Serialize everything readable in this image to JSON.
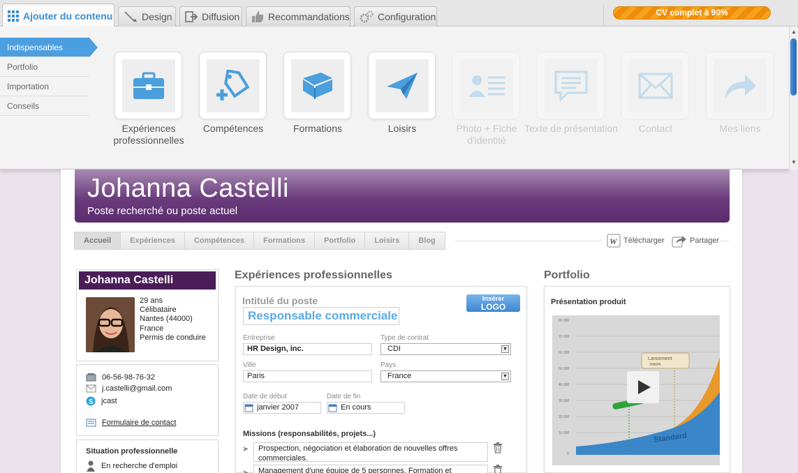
{
  "topbar": {
    "tabs": [
      {
        "label": "Ajouter du contenu",
        "icon": "grid-icon"
      },
      {
        "label": "Design",
        "icon": "brush-icon"
      },
      {
        "label": "Diffusion",
        "icon": "export-icon"
      },
      {
        "label": "Recommandations",
        "icon": "thumbs-up-icon"
      },
      {
        "label": "Configuration",
        "icon": "gears-icon"
      }
    ],
    "progress_label": "CV complet à 90%",
    "progress": 0.9
  },
  "panel": {
    "sidebar": [
      "Indispensables",
      "Portfolio",
      "Importation",
      "Conseils"
    ],
    "tiles": [
      {
        "label": "Expériences professionnelles",
        "icon": "briefcase-icon",
        "enabled": true
      },
      {
        "label": "Compétences",
        "icon": "tag-plus-icon",
        "enabled": true
      },
      {
        "label": "Formations",
        "icon": "book-icon",
        "enabled": true
      },
      {
        "label": "Loisirs",
        "icon": "paper-plane-icon",
        "enabled": true
      },
      {
        "label": "Photo + Fiche d'identité",
        "icon": "id-card-icon",
        "enabled": false
      },
      {
        "label": "Texte de présentation",
        "icon": "speech-bubble-icon",
        "enabled": false
      },
      {
        "label": "Contact",
        "icon": "envelope-icon",
        "enabled": false
      },
      {
        "label": "Mes liens",
        "icon": "link-arrow-icon",
        "enabled": false
      }
    ]
  },
  "header": {
    "name": "Johanna Castelli",
    "subtitle": "Poste recherché ou poste actuel"
  },
  "nav": {
    "tabs": [
      "Accueil",
      "Expériences",
      "Compétences",
      "Formations",
      "Portfolio",
      "Loisirs",
      "Blog"
    ],
    "download_label": "Télécharger",
    "share_label": "Partager"
  },
  "profile": {
    "name": "Johanna Castelli",
    "age": "29 ans",
    "status": "Célibataire",
    "city": "Nantes (44000)",
    "country": "France",
    "license": "Permis de conduire",
    "phone": "06-56-98-76-32",
    "email": "j.castelli@gmail.com",
    "skype": "jcast",
    "contact_form": "Formulaire de contact",
    "situation_title": "Situation professionnelle",
    "situation": "En recherche d'emploi"
  },
  "experience": {
    "section_title": "Expériences professionnelles",
    "job_title_label": "Intitulé du poste",
    "job_title": "Responsable commerciale",
    "logo_button_top": "Insérer",
    "logo_button_bottom": "LOGO",
    "company_label": "Entreprise",
    "company": "HR Design, inc.",
    "contract_label": "Type de contrat",
    "contract": "CDI",
    "city_label": "Ville",
    "city": "Paris",
    "country_label": "Pays",
    "country": "France",
    "start_label": "Date de début",
    "start": "janvier 2007",
    "end_label": "Date de fin",
    "end": "En cours",
    "missions_label": "Missions (responsabilités, projets...)",
    "missions": [
      "Prospection, négociation et élaboration de nouvelles offres commerciales.",
      "Management d'une équipe de 5 personnes. Formation et"
    ]
  },
  "portfolio": {
    "section_title": "Portfolio",
    "item_title": "Présentation produit",
    "chart_labels": {
      "callout_top": "Lancement",
      "callout_bottom": "2MKPA",
      "area": "Standard"
    },
    "y_ticks": [
      "80 000",
      "70 000",
      "60 000",
      "50 000",
      "40 000",
      "30 000",
      "20 000",
      "10 000",
      "0"
    ]
  }
}
